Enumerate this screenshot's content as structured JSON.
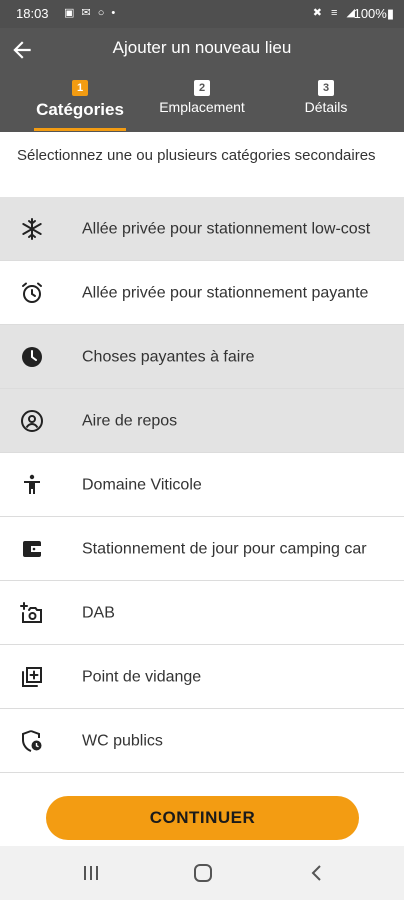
{
  "status_bar": {
    "time": "18:03",
    "left_icons": "▣ ✉ ○ •",
    "right_icons": "✖ ≡ ◢",
    "battery": "100%▮"
  },
  "header": {
    "title": "Ajouter un nouveau lieu",
    "steps": [
      {
        "number": "1",
        "label": "Catégories",
        "active": true
      },
      {
        "number": "2",
        "label": "Emplacement",
        "active": false
      },
      {
        "number": "3",
        "label": "Détails",
        "active": false
      }
    ]
  },
  "instructions": "Sélectionnez une ou plusieurs catégories secondaires",
  "categories": [
    {
      "label": "Allée privée pour stationnement low-cost",
      "icon": "snowflake-icon",
      "selected": true
    },
    {
      "label": "Allée privée pour stationnement payante",
      "icon": "alarm-clock-icon",
      "selected": false
    },
    {
      "label": "Choses payantes à faire",
      "icon": "clock-icon",
      "selected": true
    },
    {
      "label": "Aire de repos",
      "icon": "account-circle-icon",
      "selected": true
    },
    {
      "label": "Domaine Viticole",
      "icon": "person-icon",
      "selected": false
    },
    {
      "label": "Stationnement de jour pour camping car",
      "icon": "wallet-icon",
      "selected": false
    },
    {
      "label": "DAB",
      "icon": "add-camera-icon",
      "selected": false
    },
    {
      "label": "Point de vidange",
      "icon": "library-add-icon",
      "selected": false
    },
    {
      "label": "WC publics",
      "icon": "shield-clock-icon",
      "selected": false
    }
  ],
  "continue_button": "CONTINUER",
  "colors": {
    "accent": "#f39c12",
    "header_bg": "#555555",
    "selected_row_bg": "#e3e3e3"
  }
}
